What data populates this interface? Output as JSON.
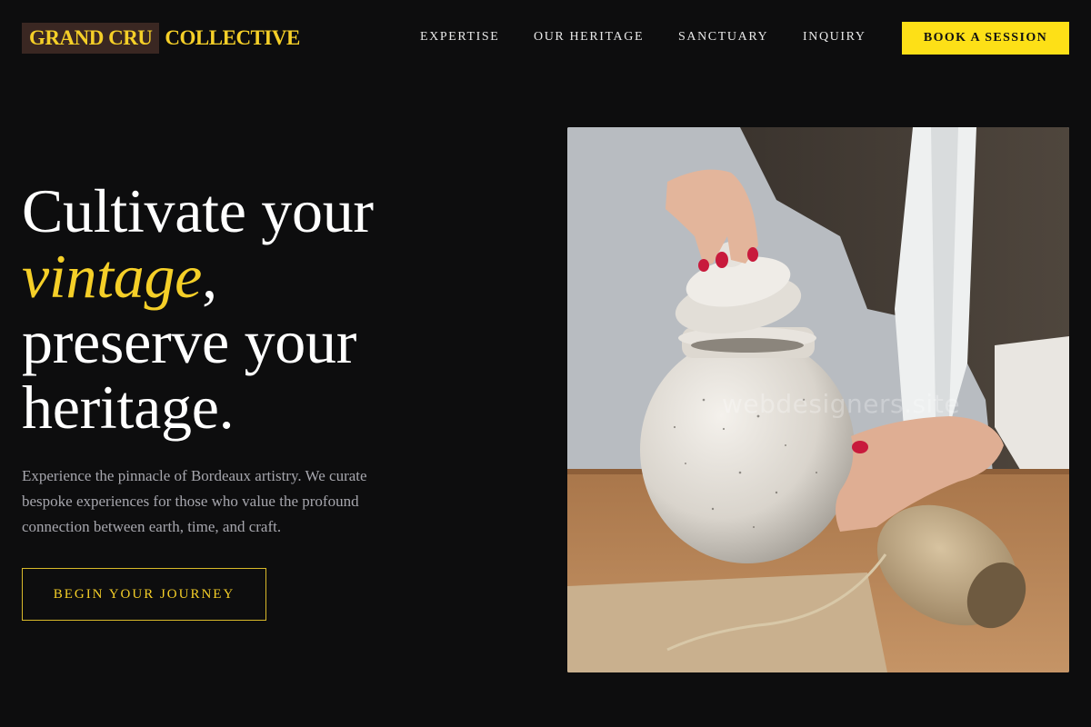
{
  "brand": {
    "name_highlight": "GRAND CRU",
    "name_rest": "COLLECTIVE"
  },
  "nav": {
    "items": [
      "EXPERTISE",
      "OUR HERITAGE",
      "SANCTUARY",
      "INQUIRY"
    ],
    "cta": "BOOK A SESSION"
  },
  "hero": {
    "line1": "Cultivate your",
    "accent": "vintage",
    "accent_suffix": ",",
    "line3": "preserve your",
    "line4": "heritage.",
    "description": "Experience the pinnacle of Bordeaux artistry. We curate bespoke experiences for those who value the profound connection between earth, time, and craft.",
    "button": "BEGIN YOUR JOURNEY"
  },
  "image": {
    "watermark": "webdesigners.site"
  },
  "colors": {
    "background": "#0d0d0e",
    "accent": "#f5cf28",
    "cta_background": "#fde017",
    "logo_box": "#3a2722",
    "muted_text": "#a6a6ad"
  }
}
